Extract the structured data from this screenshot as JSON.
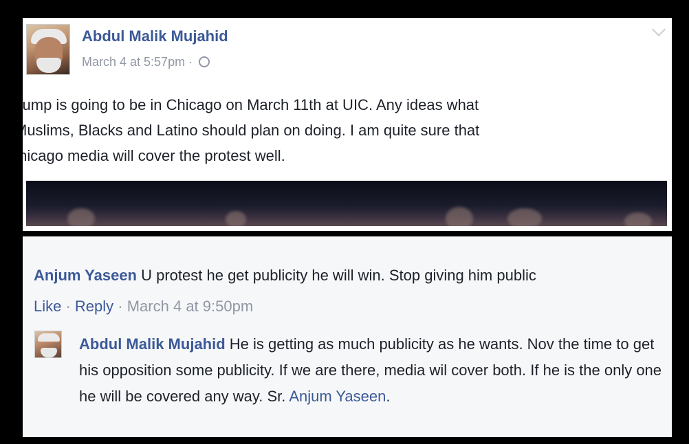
{
  "post": {
    "author": "Abdul Malik Mujahid",
    "timestamp": "March 4 at 5:57pm",
    "separator": " · ",
    "privacy_icon": "globe-icon",
    "text": "'rump is going to be in Chicago on March 11th at UIC. Any ideas what\nΜuslims, Blacks and Latino should plan on doing. I am quite sure that\n:hicago media will cover the protest well."
  },
  "comment": {
    "author": "Anjum Yaseen",
    "text": " U protest he get publicity he will win. Stop giving him public",
    "like_label": "Like",
    "sep1": " · ",
    "reply_label": "Reply",
    "sep2": " · ",
    "timestamp": "March 4 at 9:50pm"
  },
  "reply": {
    "author": "Abdul Malik Mujahid",
    "text": " He is getting as much publicity as he wants. Nov the time to get his opposition some publicity. If we are there, media wil cover both. If he is the only one he will be covered any way. Sr. ",
    "mention": "Anjum Yaseen",
    "end": "."
  },
  "colors": {
    "link": "#3b5998",
    "meta": "#9197a3",
    "text": "#1d2129",
    "comment_bg": "#f6f7f9"
  }
}
